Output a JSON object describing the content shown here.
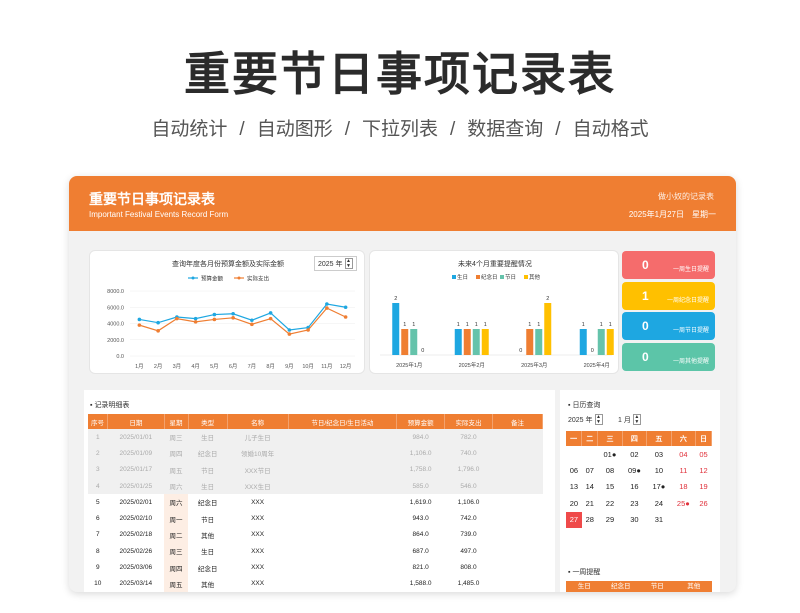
{
  "hero": {
    "title": "重要节日事项记录表",
    "features": [
      "自动统计",
      "自动图形",
      "下拉列表",
      "数据查询",
      "自动格式"
    ]
  },
  "header": {
    "title": "重要节日事项记录表",
    "subtitle": "Important Festival Events Record Form",
    "brand": "做小奴的记录表",
    "date": "2025年1月27日",
    "weekday": "星期一"
  },
  "chart1": {
    "title": "查询年度各月份预算金额及实际金额",
    "year": "2025 年"
  },
  "chart2": {
    "title": "未来4个月重要提醒情况"
  },
  "chart_data": [
    {
      "type": "line",
      "title": "查询年度各月份预算金额及实际金额",
      "categories": [
        "1月",
        "2月",
        "3月",
        "4月",
        "5月",
        "6月",
        "7月",
        "8月",
        "9月",
        "10月",
        "11月",
        "12月"
      ],
      "series": [
        {
          "name": "预算金额",
          "color": "#1ea7e1",
          "values": [
            4500,
            4100,
            4800,
            4600,
            5100,
            5200,
            4400,
            5300,
            3200,
            3500,
            6400,
            6000
          ]
        },
        {
          "name": "实际支出",
          "color": "#ef7e32",
          "values": [
            3800,
            3100,
            4600,
            4200,
            4500,
            4700,
            3900,
            4600,
            2700,
            3200,
            5900,
            4800
          ]
        }
      ],
      "yticks": [
        "0.0",
        "2000.0",
        "4000.0",
        "6000.0",
        "8000.0"
      ],
      "ylim": [
        0,
        8000
      ]
    },
    {
      "type": "bar",
      "title": "未来4个月重要提醒情况",
      "categories": [
        "2025年1月",
        "2025年2月",
        "2025年3月",
        "2025年4月"
      ],
      "series": [
        {
          "name": "生日",
          "color": "#1ea7e1",
          "values": [
            2,
            1,
            0,
            1
          ]
        },
        {
          "name": "纪念日",
          "color": "#ef7e32",
          "values": [
            1,
            1,
            1,
            0
          ]
        },
        {
          "name": "节日",
          "color": "#65c3ab",
          "values": [
            1,
            1,
            1,
            1
          ]
        },
        {
          "name": "其他",
          "color": "#ffc000",
          "values": [
            0,
            1,
            2,
            1
          ]
        }
      ]
    }
  ],
  "tiles": [
    {
      "num": "0",
      "label": "一周生日提醒",
      "color": "#f56c6c"
    },
    {
      "num": "1",
      "label": "一周纪念日提醒",
      "color": "#ffc000"
    },
    {
      "num": "0",
      "label": "一周节日提醒",
      "color": "#1ea7e1"
    },
    {
      "num": "0",
      "label": "一周其他提醒",
      "color": "#5cc5a8"
    }
  ],
  "records": {
    "section": "记录明细表",
    "headers": [
      "序号",
      "日期",
      "星期",
      "类型",
      "名称",
      "节日/纪念日/生日活动",
      "预算金额",
      "实际支出",
      "备注"
    ],
    "rows": [
      [
        "1",
        "2025/01/01",
        "周三",
        "生日",
        "儿子生日",
        "",
        "984.0",
        "782.0",
        "",
        true
      ],
      [
        "2",
        "2025/01/09",
        "周四",
        "纪念日",
        "领婚10周年",
        "",
        "1,106.0",
        "740.0",
        "",
        true
      ],
      [
        "3",
        "2025/01/17",
        "周五",
        "节日",
        "XXX节日",
        "",
        "1,758.0",
        "1,796.0",
        "",
        true
      ],
      [
        "4",
        "2025/01/25",
        "周六",
        "生日",
        "XXX生日",
        "",
        "585.0",
        "546.0",
        "",
        true
      ],
      [
        "5",
        "2025/02/01",
        "周六",
        "纪念日",
        "XXX",
        "",
        "1,619.0",
        "1,106.0",
        "",
        false
      ],
      [
        "6",
        "2025/02/10",
        "周一",
        "节日",
        "XXX",
        "",
        "943.0",
        "742.0",
        "",
        false
      ],
      [
        "7",
        "2025/02/18",
        "周二",
        "其他",
        "XXX",
        "",
        "864.0",
        "739.0",
        "",
        false
      ],
      [
        "8",
        "2025/02/26",
        "周三",
        "生日",
        "XXX",
        "",
        "687.0",
        "497.0",
        "",
        false
      ],
      [
        "9",
        "2025/03/06",
        "周四",
        "纪念日",
        "XXX",
        "",
        "821.0",
        "808.0",
        "",
        false
      ],
      [
        "10",
        "2025/03/14",
        "周五",
        "其他",
        "XXX",
        "",
        "1,588.0",
        "1,485.0",
        "",
        false
      ]
    ]
  },
  "calendar": {
    "section": "日历查询",
    "year": "2025 年",
    "month": "1 月",
    "days": [
      "一",
      "二",
      "三",
      "四",
      "五",
      "六",
      "日"
    ],
    "weeks": [
      [
        "",
        "",
        "01●",
        "02",
        "03",
        "04",
        "05"
      ],
      [
        "06",
        "07",
        "08",
        "09●",
        "10",
        "11",
        "12"
      ],
      [
        "13",
        "14",
        "15",
        "16",
        "17●",
        "18",
        "19"
      ],
      [
        "20",
        "21",
        "22",
        "23",
        "24",
        "25●",
        "26"
      ],
      [
        "27",
        "28",
        "29",
        "30",
        "31",
        "",
        ""
      ]
    ],
    "week_section": "一周提醒",
    "week_headers": [
      "生日",
      "纪念日",
      "节日",
      "其他"
    ]
  }
}
